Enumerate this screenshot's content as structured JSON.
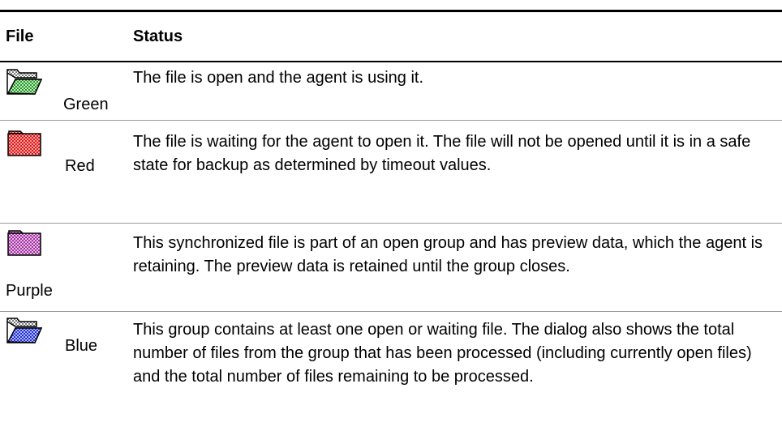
{
  "table": {
    "headers": {
      "file": "File",
      "status": "Status"
    },
    "rows": [
      {
        "icon": "green-folder-icon",
        "color_name": "Green",
        "color_hex": "#2a9a2a",
        "status": "The file is open and the agent is using it."
      },
      {
        "icon": "red-folder-icon",
        "color_name": "Red",
        "color_hex": "#e01818",
        "status": "The file is waiting for the agent to open it. The file will not be opened until it is in a safe state for backup as determined by timeout values."
      },
      {
        "icon": "purple-folder-icon",
        "color_name": "Purple",
        "color_hex": "#b040b0",
        "status": "This synchronized file is part of an open group and has preview data, which the agent is retaining. The preview data is retained until the group closes."
      },
      {
        "icon": "blue-folder-icon",
        "color_name": "Blue",
        "color_hex": "#2030d8",
        "status": "This group contains at least one open or waiting file. The dialog also shows the total number of files from the group that has been processed (including currently open files) and the total number of files remaining to be processed."
      }
    ]
  }
}
